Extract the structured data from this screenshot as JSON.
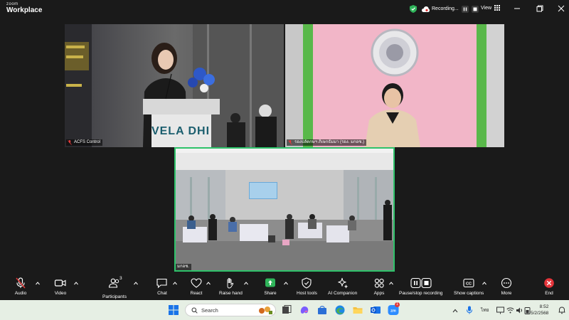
{
  "titlebar": {
    "brand_small": "zoom",
    "brand_main": "Workplace",
    "recording_label": "Recording...",
    "view_label": "View"
  },
  "tiles": [
    {
      "name": "ACFS Control",
      "podium_text": "VELA DHI",
      "podium_sub": "VELA DHI"
    },
    {
      "name": "รองปลัดกษฯ ภิเษกธัมมา (รอง. มกอช.)"
    },
    {
      "name": "มกอช."
    }
  ],
  "toolbar": {
    "items": [
      {
        "id": "audio",
        "label": "Audio"
      },
      {
        "id": "video",
        "label": "Video"
      },
      {
        "id": "participants",
        "label": "Participants",
        "count": "3"
      },
      {
        "id": "chat",
        "label": "Chat"
      },
      {
        "id": "react",
        "label": "React"
      },
      {
        "id": "raise-hand",
        "label": "Raise hand"
      },
      {
        "id": "share",
        "label": "Share"
      },
      {
        "id": "host-tools",
        "label": "Host tools"
      },
      {
        "id": "ai-companion",
        "label": "AI Companion"
      },
      {
        "id": "apps",
        "label": "Apps"
      },
      {
        "id": "pause-stop-recording",
        "label": "Pause/stop recording"
      },
      {
        "id": "show-captions",
        "label": "Show captions"
      },
      {
        "id": "more",
        "label": "More"
      },
      {
        "id": "end",
        "label": "End"
      }
    ]
  },
  "taskbar": {
    "search_placeholder": "Search",
    "mail_badge": "1",
    "input_lang": "ไทย",
    "time": "8:52",
    "date": "5/2/2568"
  },
  "colors": {
    "accent_green": "#2fb45a",
    "recording_red": "#e03a3a",
    "end_red": "#e5343a",
    "active_speaker": "#2ec26a"
  }
}
